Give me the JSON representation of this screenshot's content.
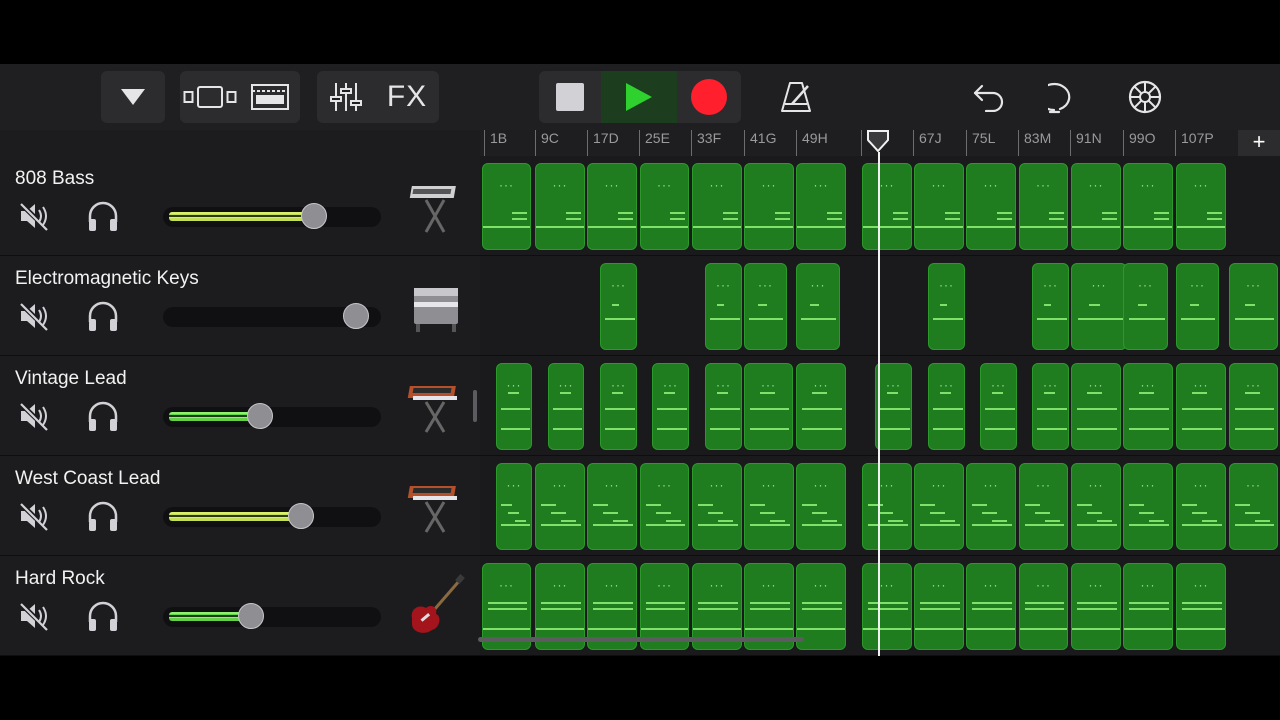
{
  "toolbar": {
    "fx_label": "FX"
  },
  "ruler": {
    "ticks": [
      "1B",
      "9C",
      "17D",
      "25E",
      "33F",
      "41G",
      "49H",
      "59",
      "67J",
      "75L",
      "83M",
      "91N",
      "99O",
      "107P"
    ],
    "add_label": "+"
  },
  "tracks": [
    {
      "name": "808 Bass",
      "volume": 0.72,
      "instrument": "keyboard-stand-icon"
    },
    {
      "name": "Electromagnetic Keys",
      "volume": 0.94,
      "instrument": "electric-piano-icon"
    },
    {
      "name": "Vintage Lead",
      "volume": 0.44,
      "instrument": "synth-stand-icon"
    },
    {
      "name": "West Coast Lead",
      "volume": 0.65,
      "instrument": "synth-stand-icon"
    },
    {
      "name": "Hard Rock",
      "volume": 0.39,
      "instrument": "electric-guitar-icon"
    }
  ],
  "colors": {
    "region_green": "#1f7d1f",
    "record_red": "#ff1f2d",
    "play_green": "#2ed12e"
  }
}
